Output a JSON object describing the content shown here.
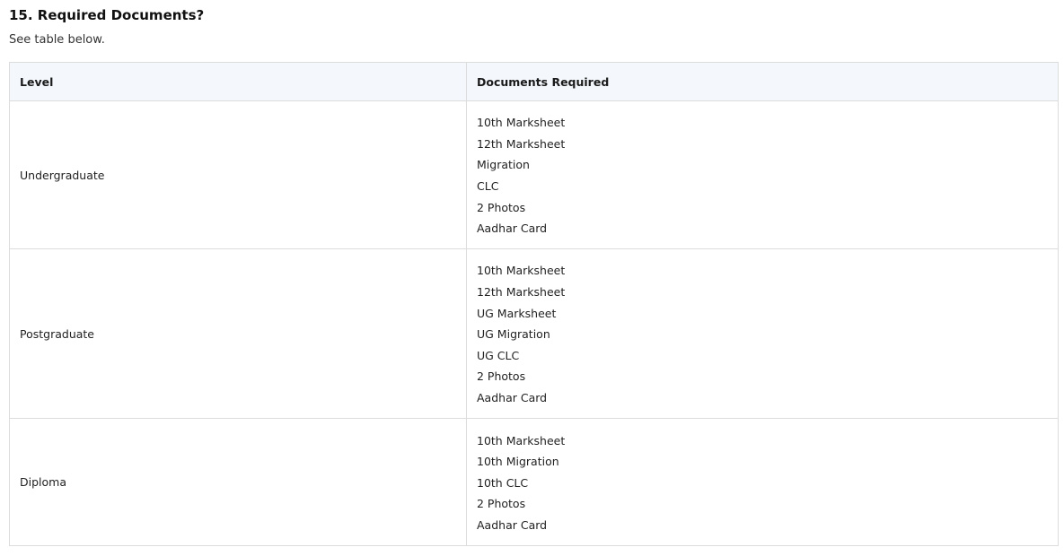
{
  "section": {
    "heading": "15. Required Documents?",
    "intro": "See table below."
  },
  "table": {
    "headers": [
      "Level",
      "Documents Required"
    ],
    "rows": [
      {
        "level": "Undergraduate",
        "documents": [
          "10th Marksheet",
          "12th Marksheet",
          "Migration",
          "CLC",
          "2 Photos",
          "Aadhar Card"
        ]
      },
      {
        "level": "Postgraduate",
        "documents": [
          "10th Marksheet",
          "12th Marksheet",
          "UG Marksheet",
          "UG Migration",
          "UG CLC",
          "2 Photos",
          "Aadhar Card"
        ]
      },
      {
        "level": "Diploma",
        "documents": [
          "10th Marksheet",
          "10th Migration",
          "10th CLC",
          "2 Photos",
          "Aadhar Card"
        ]
      }
    ]
  }
}
